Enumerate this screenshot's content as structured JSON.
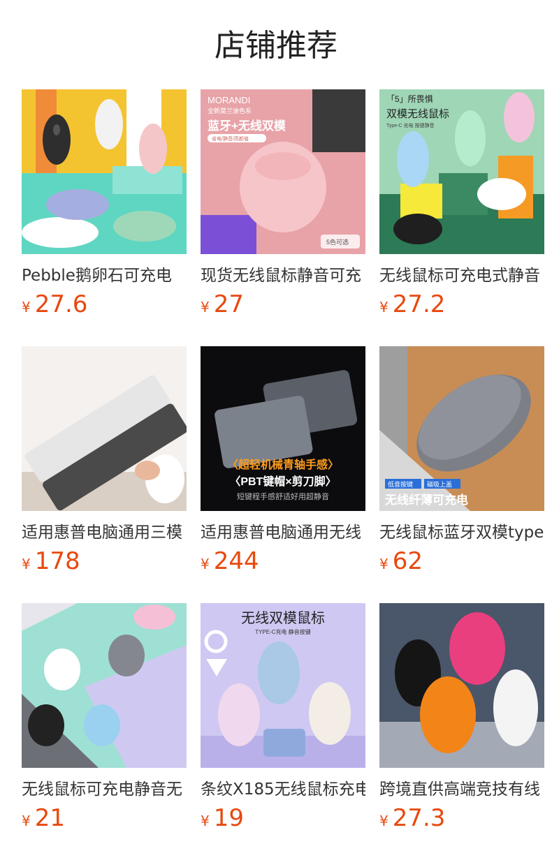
{
  "section": {
    "title": "店铺推荐"
  },
  "products": [
    {
      "name": "Pebble鹅卵石可充电",
      "currency": "¥",
      "price": "27.6",
      "image_text": []
    },
    {
      "name": "现货无线鼠标静音可充",
      "currency": "¥",
      "price": "27",
      "image_text": [
        "MORANDI",
        "全新莫兰迪色系",
        "蓝牙+无线双模",
        "省电/静音/高颜值",
        "5色可选"
      ]
    },
    {
      "name": "无线鼠标可充电式静音",
      "currency": "¥",
      "price": "27.2",
      "image_text": [
        "「5」所畏惧",
        "双模无线鼠标",
        "Type-C 充电 按键静音"
      ]
    },
    {
      "name": "适用惠普电脑通用三模",
      "currency": "¥",
      "price": "178",
      "image_text": []
    },
    {
      "name": "适用惠普电脑通用无线",
      "currency": "¥",
      "price": "244",
      "image_text": [
        "〈超轻机械青轴手感〉",
        "〈PBT键帽×剪刀脚〉",
        "短键程手感舒适好用超静音"
      ]
    },
    {
      "name": "无线鼠标蓝牙双模type",
      "currency": "¥",
      "price": "62",
      "image_text": [
        "低音按键",
        "磁吸上盖",
        "无线纤薄可充电"
      ]
    },
    {
      "name": "无线鼠标可充电静音无",
      "currency": "¥",
      "price": "21",
      "image_text": []
    },
    {
      "name": "条纹X185无线鼠标充电",
      "currency": "¥",
      "price": "19",
      "image_text": [
        "无线双模鼠标",
        "TYPE-C充电 静音按键"
      ]
    },
    {
      "name": "跨境直供高端竞技有线",
      "currency": "¥",
      "price": "27.3",
      "image_text": []
    }
  ]
}
